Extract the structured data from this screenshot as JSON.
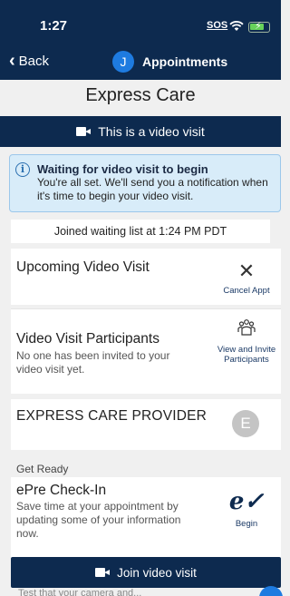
{
  "status_bar": {
    "time": "1:27",
    "sos": "SOS"
  },
  "nav": {
    "back_label": "Back",
    "avatar_initial": "J",
    "title": "Appointments"
  },
  "page": {
    "title": "Express Care"
  },
  "video_banner": {
    "label": "This is a video visit"
  },
  "info": {
    "title": "Waiting for video visit to begin",
    "body": "You're all set. We'll send you a notification when it's time to begin your video visit."
  },
  "joined": {
    "text": "Joined waiting list at 1:24 PM PDT"
  },
  "upcoming": {
    "title": "Upcoming Video Visit",
    "cancel_label": "Cancel Appt"
  },
  "participants": {
    "title": "Video Visit Participants",
    "subtitle": "No one has been invited to your video visit yet.",
    "action_label": "View and Invite Participants"
  },
  "provider": {
    "name": "EXPRESS CARE PROVIDER",
    "avatar_initial": "E"
  },
  "get_ready": {
    "label": "Get Ready"
  },
  "checkin": {
    "title": "ePre Check-In",
    "subtitle": "Save time at your appointment by updating some of your information now.",
    "action_label": "Begin"
  },
  "join_button": {
    "label": "Join video visit"
  },
  "clipped_text": "Test that your camera and...",
  "colors": {
    "navy": "#0d2a4f",
    "accent_blue": "#1e7be0",
    "info_bg": "#d8ecf9"
  }
}
